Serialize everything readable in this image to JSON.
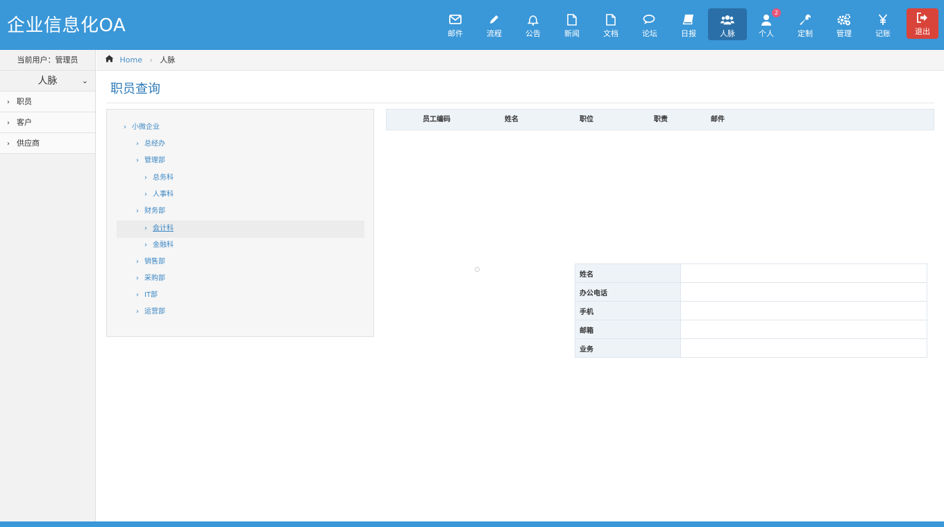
{
  "app": {
    "brand": "企业信息化OA"
  },
  "nav": {
    "items": [
      {
        "label": "邮件",
        "icon": "mail-icon"
      },
      {
        "label": "流程",
        "icon": "pencil-icon"
      },
      {
        "label": "公告",
        "icon": "bell-icon"
      },
      {
        "label": "新闻",
        "icon": "file-icon"
      },
      {
        "label": "文档",
        "icon": "document-icon"
      },
      {
        "label": "论坛",
        "icon": "chat-icon"
      },
      {
        "label": "日报",
        "icon": "book-icon"
      },
      {
        "label": "人脉",
        "icon": "users-icon",
        "active": true
      },
      {
        "label": "个人",
        "icon": "user-icon",
        "badge": "2"
      },
      {
        "label": "定制",
        "icon": "wrench-icon"
      },
      {
        "label": "管理",
        "icon": "gears-icon"
      },
      {
        "label": "记账",
        "icon": "yen-icon"
      }
    ],
    "logout": "退出"
  },
  "sidebar": {
    "current_user": "当前用户：管理员",
    "section": "人脉",
    "items": [
      {
        "label": "职员"
      },
      {
        "label": "客户"
      },
      {
        "label": "供应商"
      }
    ]
  },
  "breadcrumb": {
    "home": "Home",
    "current": "人脉"
  },
  "page": {
    "title": "职员查询"
  },
  "tree": {
    "nodes": [
      {
        "label": "小微企业",
        "level": 0
      },
      {
        "label": "总经办",
        "level": 1
      },
      {
        "label": "管理部",
        "level": 1
      },
      {
        "label": "总务科",
        "level": 2
      },
      {
        "label": "人事科",
        "level": 2
      },
      {
        "label": "财务部",
        "level": 1
      },
      {
        "label": "会计科",
        "level": 2,
        "selected": true
      },
      {
        "label": "金融科",
        "level": 2
      },
      {
        "label": "销售部",
        "level": 1
      },
      {
        "label": "采购部",
        "level": 1
      },
      {
        "label": "IT部",
        "level": 1
      },
      {
        "label": "运营部",
        "level": 1
      }
    ]
  },
  "employee_table": {
    "columns": [
      "员工编码",
      "姓名",
      "职位",
      "职责",
      "邮件"
    ],
    "rows": []
  },
  "detail": {
    "fields": [
      {
        "label": "姓名",
        "value": ""
      },
      {
        "label": "办公电话",
        "value": ""
      },
      {
        "label": "手机",
        "value": ""
      },
      {
        "label": "邮箱",
        "value": ""
      },
      {
        "label": "业务",
        "value": ""
      }
    ]
  },
  "colors": {
    "primary": "#3a97d8",
    "active_nav": "#2a6fa8",
    "logout": "#d9443a",
    "link": "#3d88c4",
    "badge": "#e6577a"
  }
}
